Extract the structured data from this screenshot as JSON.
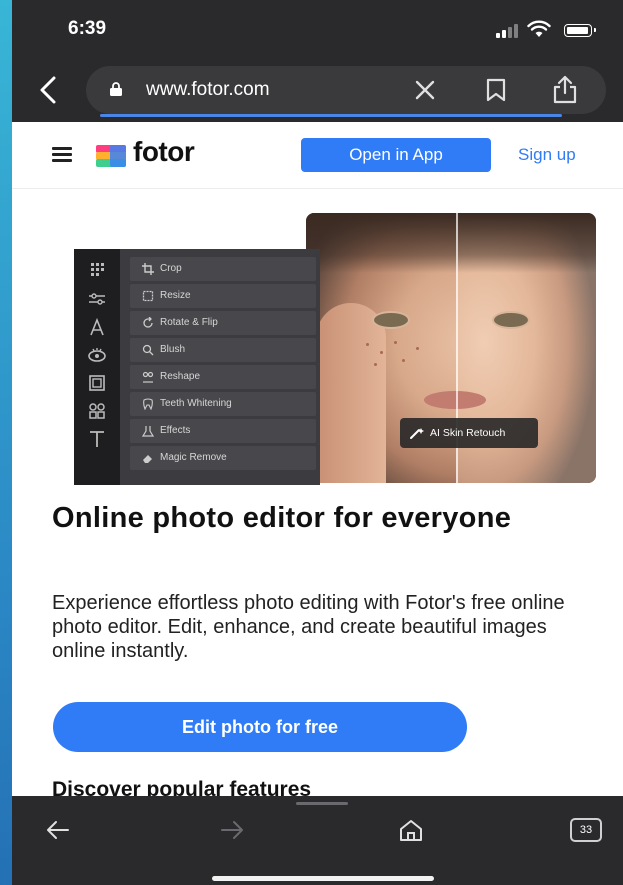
{
  "status_bar": {
    "time": "6:39"
  },
  "browser": {
    "url": "www.fotor.com",
    "open_tabs": "33",
    "icons": [
      "back-chevron-icon",
      "lock-icon",
      "clear-icon",
      "bookmark-icon",
      "share-icon",
      "nav-back-icon",
      "nav-forward-icon",
      "home-icon",
      "tabs-icon"
    ]
  },
  "site_header": {
    "logo_text": "fotor",
    "open_app_label": "Open in App",
    "signup_label": "Sign up"
  },
  "hero": {
    "tools": [
      "Crop",
      "Resize",
      "Rotate & Flip",
      "Blush",
      "Reshape",
      "Teeth Whitening",
      "Effects",
      "Magic Remove"
    ],
    "badge_label": "AI Skin Retouch"
  },
  "content": {
    "headline": "Online photo editor for everyone",
    "description": "Experience effortless photo editing with Fotor's free online photo editor. Edit, enhance, and create beautiful images online instantly.",
    "cta_label": "Edit photo for free",
    "section_heading": "Discover popular features"
  },
  "colors": {
    "brand_blue": "#2f7cf6",
    "chrome_dark": "#2a2a2c"
  }
}
